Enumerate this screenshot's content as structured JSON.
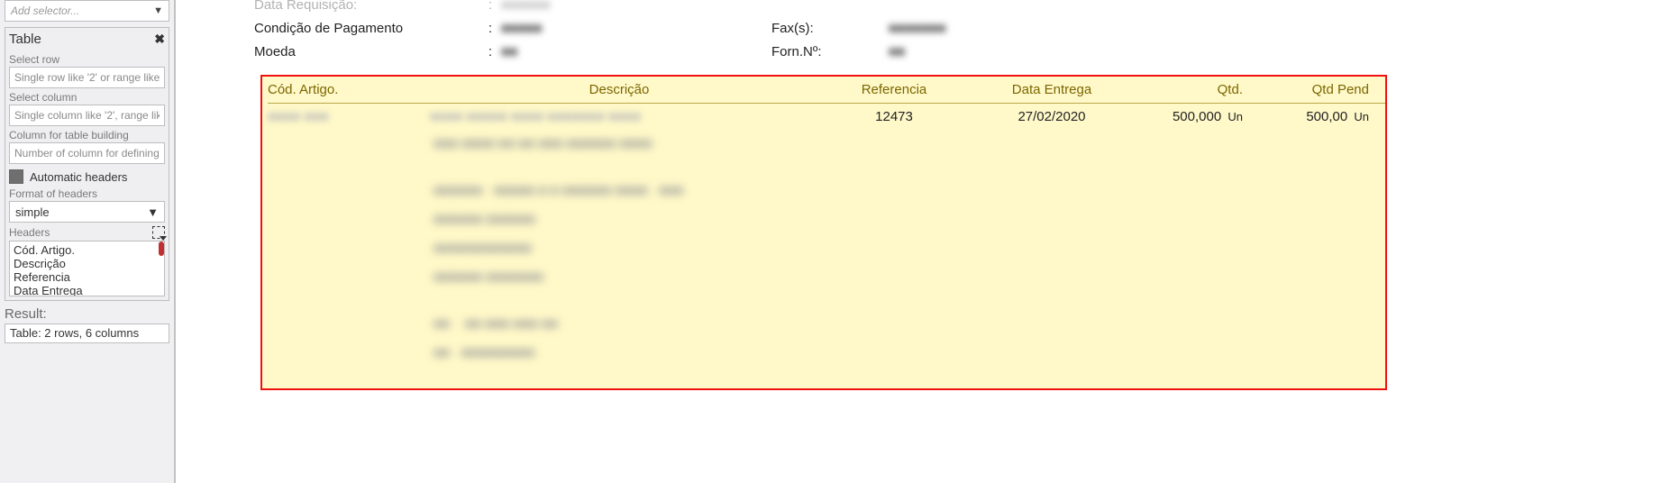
{
  "sidebar": {
    "add_selector_placeholder": "Add selector...",
    "table_section_title": "Table",
    "select_row_label": "Select row",
    "select_row_placeholder": "Single row like '2' or range like",
    "select_column_label": "Select column",
    "select_column_placeholder": "Single column like '2', range lik",
    "column_build_label": "Column for table building",
    "column_build_placeholder": "Number of column for defining",
    "automatic_headers_label": "Automatic headers",
    "format_headers_label": "Format of headers",
    "format_headers_value": "simple",
    "headers_label": "Headers",
    "headers_list": [
      "Cód. Artigo.",
      "Descrição",
      "Referencia",
      "Data Entrega"
    ],
    "result_label": "Result:",
    "result_value": "Table: 2 rows, 6 columns"
  },
  "document": {
    "header_rows": [
      {
        "label": "Data Requisição:",
        "label2": ""
      },
      {
        "label": "Condição de Pagamento",
        "label2": "Fax(s):"
      },
      {
        "label": "Moeda",
        "label2": "Forn.Nº:"
      }
    ],
    "columns": [
      "Cód. Artigo.",
      "Descrição",
      "Referencia",
      "Data Entrega",
      "Qtd.",
      "Qtd Pend"
    ],
    "rows": [
      {
        "referencia": "12473",
        "data_entrega": "27/02/2020",
        "qtd": "500,000",
        "qtd_unit": "Un",
        "qtd_pend": "500,00",
        "qtd_pend_unit": "Un"
      }
    ]
  }
}
